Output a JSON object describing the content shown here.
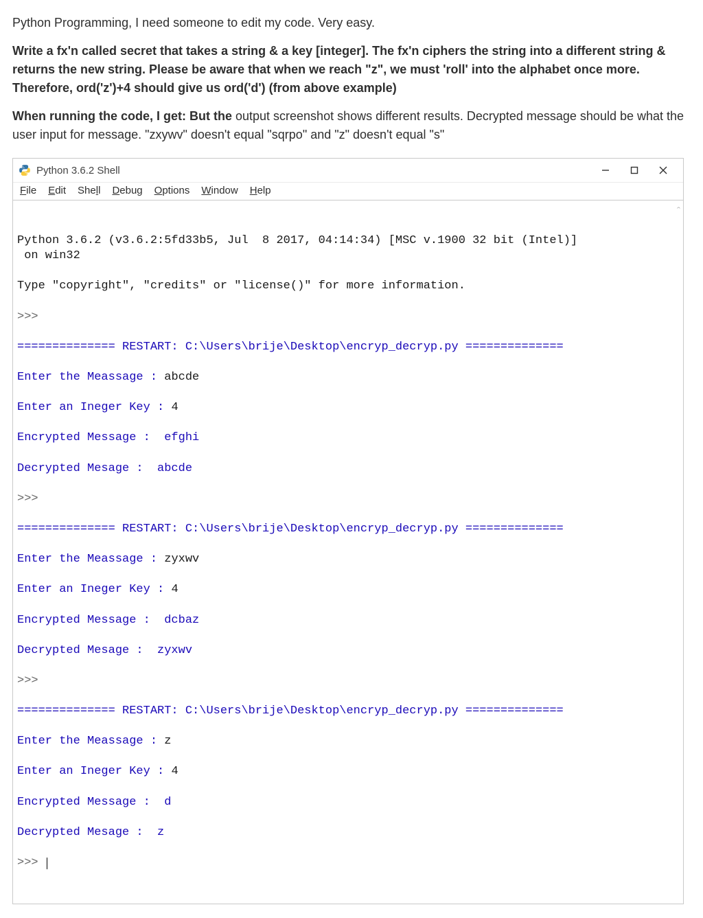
{
  "question": {
    "intro": "Python Programming, I need someone to edit my code. Very easy.",
    "spec": "Write a fx'n called secret that takes a string & a key [integer]. The fx'n ciphers the string into a different string & returns the new string. Please be aware that when we reach \"z\", we must 'roll' into the alphabet once more. Therefore, ord('z')+4 should give us ord('d') (from above example)",
    "result_bold": "When running the code, I get: But the ",
    "result_rest": "output screenshot shows different results. Decrypted message should be what the user input for message. \"zxywv\" doesn't equal \"sqrpo\" and \"z\" doesn't equal \"s\""
  },
  "shell": {
    "title": "Python 3.6.2 Shell",
    "menubar": [
      "File",
      "Edit",
      "Shell",
      "Debug",
      "Options",
      "Window",
      "Help"
    ],
    "version_line": "Python 3.6.2 (v3.6.2:5fd33b5, Jul  8 2017, 04:14:34) [MSC v.1900 32 bit (Intel)]\n on win32",
    "info_line": "Type \"copyright\", \"credits\" or \"license()\" for more information.",
    "prompt": ">>>",
    "restart_line": "============== RESTART: C:\\Users\\brije\\Desktop\\encryp_decryp.py ==============",
    "runs": [
      {
        "p1": "Enter the Meassage : ",
        "v1": "abcde",
        "p2": "Enter an Ineger Key : ",
        "v2": "4",
        "enc": "Encrypted Message :  efghi",
        "dec": "Decrypted Mesage :  abcde"
      },
      {
        "p1": "Enter the Meassage : ",
        "v1": "zyxwv",
        "p2": "Enter an Ineger Key : ",
        "v2": "4",
        "enc": "Encrypted Message :  dcbaz",
        "dec": "Decrypted Mesage :  zyxwv"
      },
      {
        "p1": "Enter the Meassage : ",
        "v1": "z",
        "p2": "Enter an Ineger Key : ",
        "v2": "4",
        "enc": "Encrypted Message :  d",
        "dec": "Decrypted Mesage :  z"
      }
    ]
  }
}
